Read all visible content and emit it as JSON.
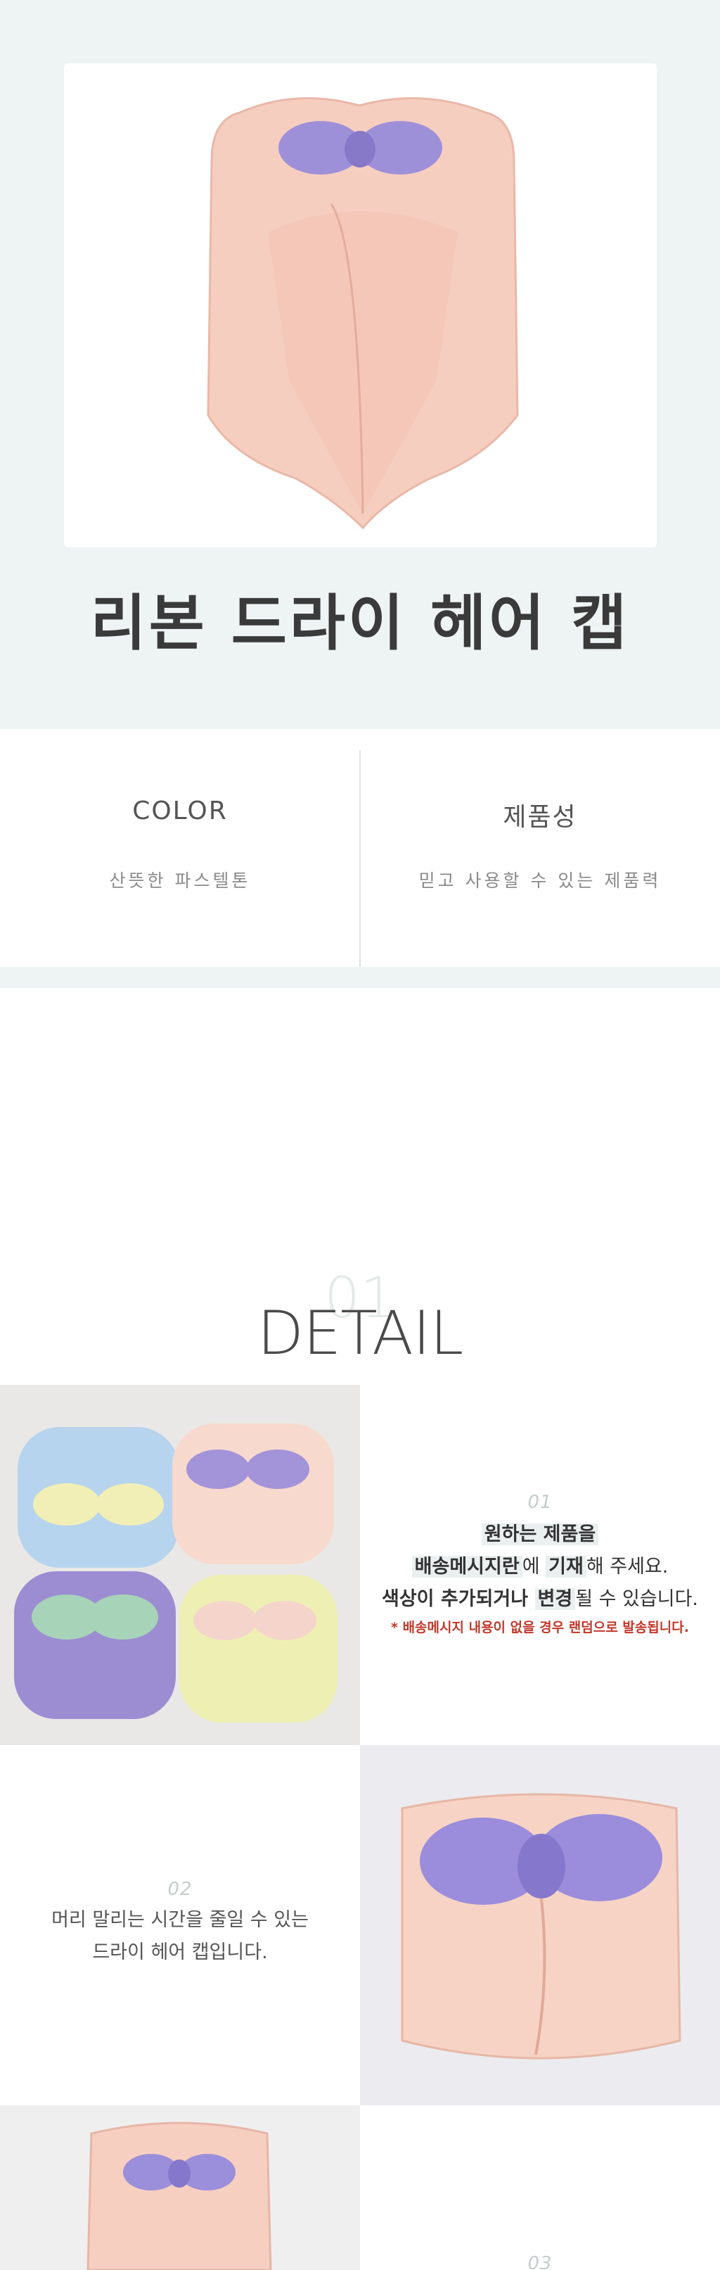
{
  "hero": {
    "title": "리본 드라이 헤어 캡",
    "photo_alt": "pink towel cap with purple bow"
  },
  "features": [
    {
      "title": "COLOR",
      "desc": "산뜻한 파스텔톤"
    },
    {
      "title": "제품성",
      "desc": "믿고 사용할 수 있는 제품력"
    }
  ],
  "detail": {
    "number": "01",
    "title": "DETAIL"
  },
  "steps": [
    {
      "num": "01",
      "line1_hl": "원하는 제품을",
      "line2_a": "배송메시지란",
      "line2_b": "에 ",
      "line2_c": "기재",
      "line2_d": "해 주세요.",
      "line3_a": "색상이 추가되거나 ",
      "line3_b": "변경",
      "line3_c": "될 수 있습니다.",
      "note": "* 배송메시지 내용이 없을 경우 랜덤으로 발송됩니다."
    },
    {
      "num": "02",
      "line1": "머리 말리는 시간을 줄일 수 있는",
      "line2": "드라이 헤어 캡입니다."
    },
    {
      "num": "03"
    }
  ]
}
